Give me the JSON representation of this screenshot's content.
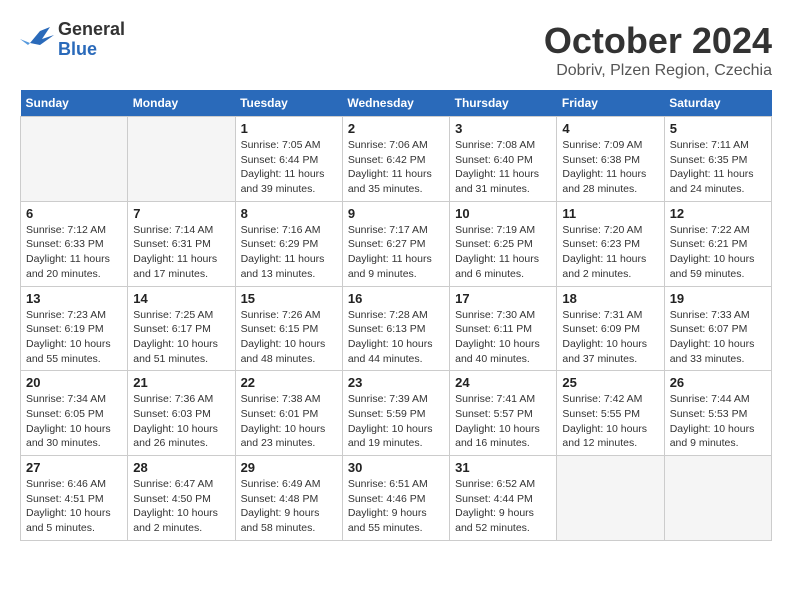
{
  "header": {
    "logo_general": "General",
    "logo_blue": "Blue",
    "month_title": "October 2024",
    "location": "Dobriv, Plzen Region, Czechia"
  },
  "days_of_week": [
    "Sunday",
    "Monday",
    "Tuesday",
    "Wednesday",
    "Thursday",
    "Friday",
    "Saturday"
  ],
  "weeks": [
    [
      {
        "day": "",
        "empty": true
      },
      {
        "day": "",
        "empty": true
      },
      {
        "day": "1",
        "sunrise": "Sunrise: 7:05 AM",
        "sunset": "Sunset: 6:44 PM",
        "daylight": "Daylight: 11 hours and 39 minutes."
      },
      {
        "day": "2",
        "sunrise": "Sunrise: 7:06 AM",
        "sunset": "Sunset: 6:42 PM",
        "daylight": "Daylight: 11 hours and 35 minutes."
      },
      {
        "day": "3",
        "sunrise": "Sunrise: 7:08 AM",
        "sunset": "Sunset: 6:40 PM",
        "daylight": "Daylight: 11 hours and 31 minutes."
      },
      {
        "day": "4",
        "sunrise": "Sunrise: 7:09 AM",
        "sunset": "Sunset: 6:38 PM",
        "daylight": "Daylight: 11 hours and 28 minutes."
      },
      {
        "day": "5",
        "sunrise": "Sunrise: 7:11 AM",
        "sunset": "Sunset: 6:35 PM",
        "daylight": "Daylight: 11 hours and 24 minutes."
      }
    ],
    [
      {
        "day": "6",
        "sunrise": "Sunrise: 7:12 AM",
        "sunset": "Sunset: 6:33 PM",
        "daylight": "Daylight: 11 hours and 20 minutes."
      },
      {
        "day": "7",
        "sunrise": "Sunrise: 7:14 AM",
        "sunset": "Sunset: 6:31 PM",
        "daylight": "Daylight: 11 hours and 17 minutes."
      },
      {
        "day": "8",
        "sunrise": "Sunrise: 7:16 AM",
        "sunset": "Sunset: 6:29 PM",
        "daylight": "Daylight: 11 hours and 13 minutes."
      },
      {
        "day": "9",
        "sunrise": "Sunrise: 7:17 AM",
        "sunset": "Sunset: 6:27 PM",
        "daylight": "Daylight: 11 hours and 9 minutes."
      },
      {
        "day": "10",
        "sunrise": "Sunrise: 7:19 AM",
        "sunset": "Sunset: 6:25 PM",
        "daylight": "Daylight: 11 hours and 6 minutes."
      },
      {
        "day": "11",
        "sunrise": "Sunrise: 7:20 AM",
        "sunset": "Sunset: 6:23 PM",
        "daylight": "Daylight: 11 hours and 2 minutes."
      },
      {
        "day": "12",
        "sunrise": "Sunrise: 7:22 AM",
        "sunset": "Sunset: 6:21 PM",
        "daylight": "Daylight: 10 hours and 59 minutes."
      }
    ],
    [
      {
        "day": "13",
        "sunrise": "Sunrise: 7:23 AM",
        "sunset": "Sunset: 6:19 PM",
        "daylight": "Daylight: 10 hours and 55 minutes."
      },
      {
        "day": "14",
        "sunrise": "Sunrise: 7:25 AM",
        "sunset": "Sunset: 6:17 PM",
        "daylight": "Daylight: 10 hours and 51 minutes."
      },
      {
        "day": "15",
        "sunrise": "Sunrise: 7:26 AM",
        "sunset": "Sunset: 6:15 PM",
        "daylight": "Daylight: 10 hours and 48 minutes."
      },
      {
        "day": "16",
        "sunrise": "Sunrise: 7:28 AM",
        "sunset": "Sunset: 6:13 PM",
        "daylight": "Daylight: 10 hours and 44 minutes."
      },
      {
        "day": "17",
        "sunrise": "Sunrise: 7:30 AM",
        "sunset": "Sunset: 6:11 PM",
        "daylight": "Daylight: 10 hours and 40 minutes."
      },
      {
        "day": "18",
        "sunrise": "Sunrise: 7:31 AM",
        "sunset": "Sunset: 6:09 PM",
        "daylight": "Daylight: 10 hours and 37 minutes."
      },
      {
        "day": "19",
        "sunrise": "Sunrise: 7:33 AM",
        "sunset": "Sunset: 6:07 PM",
        "daylight": "Daylight: 10 hours and 33 minutes."
      }
    ],
    [
      {
        "day": "20",
        "sunrise": "Sunrise: 7:34 AM",
        "sunset": "Sunset: 6:05 PM",
        "daylight": "Daylight: 10 hours and 30 minutes."
      },
      {
        "day": "21",
        "sunrise": "Sunrise: 7:36 AM",
        "sunset": "Sunset: 6:03 PM",
        "daylight": "Daylight: 10 hours and 26 minutes."
      },
      {
        "day": "22",
        "sunrise": "Sunrise: 7:38 AM",
        "sunset": "Sunset: 6:01 PM",
        "daylight": "Daylight: 10 hours and 23 minutes."
      },
      {
        "day": "23",
        "sunrise": "Sunrise: 7:39 AM",
        "sunset": "Sunset: 5:59 PM",
        "daylight": "Daylight: 10 hours and 19 minutes."
      },
      {
        "day": "24",
        "sunrise": "Sunrise: 7:41 AM",
        "sunset": "Sunset: 5:57 PM",
        "daylight": "Daylight: 10 hours and 16 minutes."
      },
      {
        "day": "25",
        "sunrise": "Sunrise: 7:42 AM",
        "sunset": "Sunset: 5:55 PM",
        "daylight": "Daylight: 10 hours and 12 minutes."
      },
      {
        "day": "26",
        "sunrise": "Sunrise: 7:44 AM",
        "sunset": "Sunset: 5:53 PM",
        "daylight": "Daylight: 10 hours and 9 minutes."
      }
    ],
    [
      {
        "day": "27",
        "sunrise": "Sunrise: 6:46 AM",
        "sunset": "Sunset: 4:51 PM",
        "daylight": "Daylight: 10 hours and 5 minutes."
      },
      {
        "day": "28",
        "sunrise": "Sunrise: 6:47 AM",
        "sunset": "Sunset: 4:50 PM",
        "daylight": "Daylight: 10 hours and 2 minutes."
      },
      {
        "day": "29",
        "sunrise": "Sunrise: 6:49 AM",
        "sunset": "Sunset: 4:48 PM",
        "daylight": "Daylight: 9 hours and 58 minutes."
      },
      {
        "day": "30",
        "sunrise": "Sunrise: 6:51 AM",
        "sunset": "Sunset: 4:46 PM",
        "daylight": "Daylight: 9 hours and 55 minutes."
      },
      {
        "day": "31",
        "sunrise": "Sunrise: 6:52 AM",
        "sunset": "Sunset: 4:44 PM",
        "daylight": "Daylight: 9 hours and 52 minutes."
      },
      {
        "day": "",
        "empty": true
      },
      {
        "day": "",
        "empty": true
      }
    ]
  ]
}
